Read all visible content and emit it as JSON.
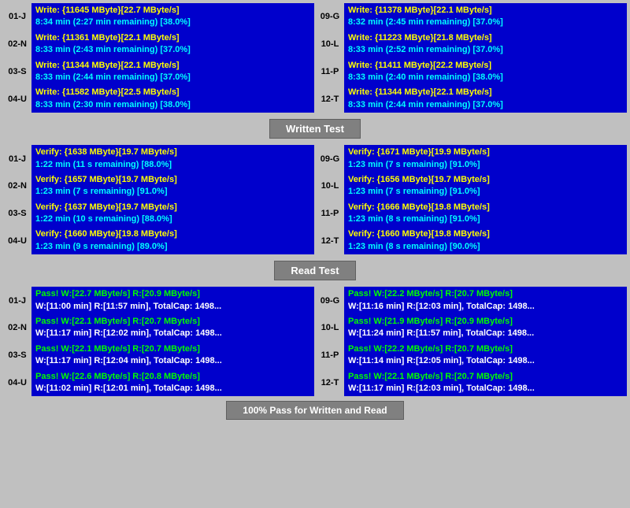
{
  "sections": {
    "write_test": {
      "label": "Written Test",
      "rows": [
        {
          "left": {
            "id": "01-J",
            "line1": "Write: {11645 MByte}[22.7 MByte/s]",
            "line2": "8:34 min (2:27 min remaining)  [38.0%]"
          },
          "right": {
            "id": "09-G",
            "line1": "Write: {11378 MByte}[22.1 MByte/s]",
            "line2": "8:32 min (2:45 min remaining)  [37.0%]"
          }
        },
        {
          "left": {
            "id": "02-N",
            "line1": "Write: {11361 MByte}[22.1 MByte/s]",
            "line2": "8:33 min (2:43 min remaining)  [37.0%]"
          },
          "right": {
            "id": "10-L",
            "line1": "Write: {11223 MByte}[21.8 MByte/s]",
            "line2": "8:33 min (2:52 min remaining)  [37.0%]"
          }
        },
        {
          "left": {
            "id": "03-S",
            "line1": "Write: {11344 MByte}[22.1 MByte/s]",
            "line2": "8:33 min (2:44 min remaining)  [37.0%]"
          },
          "right": {
            "id": "11-P",
            "line1": "Write: {11411 MByte}[22.2 MByte/s]",
            "line2": "8:33 min (2:40 min remaining)  [38.0%]"
          }
        },
        {
          "left": {
            "id": "04-U",
            "line1": "Write: {11582 MByte}[22.5 MByte/s]",
            "line2": "8:33 min (2:30 min remaining)  [38.0%]"
          },
          "right": {
            "id": "12-T",
            "line1": "Write: {11344 MByte}[22.1 MByte/s]",
            "line2": "8:33 min (2:44 min remaining)  [37.0%]"
          }
        }
      ]
    },
    "verify_test": {
      "label": "Written Test",
      "rows": [
        {
          "left": {
            "id": "01-J",
            "line1": "Verify: {1638 MByte}[19.7 MByte/s]",
            "line2": "1:22 min (11 s remaining)   [88.0%]"
          },
          "right": {
            "id": "09-G",
            "line1": "Verify: {1671 MByte}[19.9 MByte/s]",
            "line2": "1:23 min (7 s remaining)   [91.0%]"
          }
        },
        {
          "left": {
            "id": "02-N",
            "line1": "Verify: {1657 MByte}[19.7 MByte/s]",
            "line2": "1:23 min (7 s remaining)   [91.0%]"
          },
          "right": {
            "id": "10-L",
            "line1": "Verify: {1656 MByte}[19.7 MByte/s]",
            "line2": "1:23 min (7 s remaining)   [91.0%]"
          }
        },
        {
          "left": {
            "id": "03-S",
            "line1": "Verify: {1637 MByte}[19.7 MByte/s]",
            "line2": "1:22 min (10 s remaining)   [88.0%]"
          },
          "right": {
            "id": "11-P",
            "line1": "Verify: {1666 MByte}[19.8 MByte/s]",
            "line2": "1:23 min (8 s remaining)   [91.0%]"
          }
        },
        {
          "left": {
            "id": "04-U",
            "line1": "Verify: {1660 MByte}[19.8 MByte/s]",
            "line2": "1:23 min (9 s remaining)   [89.0%]"
          },
          "right": {
            "id": "12-T",
            "line1": "Verify: {1660 MByte}[19.8 MByte/s]",
            "line2": "1:23 min (8 s remaining)   [90.0%]"
          }
        }
      ]
    },
    "read_test": {
      "label": "Read Test",
      "rows": [
        {
          "left": {
            "id": "01-J",
            "line1": "Pass! W:[22.7 MByte/s] R:[20.9 MByte/s]",
            "line2": "W:[11:00 min] R:[11:57 min], TotalCap: 1498..."
          },
          "right": {
            "id": "09-G",
            "line1": "Pass! W:[22.2 MByte/s] R:[20.7 MByte/s]",
            "line2": "W:[11:16 min] R:[12:03 min], TotalCap: 1498..."
          }
        },
        {
          "left": {
            "id": "02-N",
            "line1": "Pass! W:[22.1 MByte/s] R:[20.7 MByte/s]",
            "line2": "W:[11:17 min] R:[12:02 min], TotalCap: 1498..."
          },
          "right": {
            "id": "10-L",
            "line1": "Pass! W:[21.9 MByte/s] R:[20.9 MByte/s]",
            "line2": "W:[11:24 min] R:[11:57 min], TotalCap: 1498..."
          }
        },
        {
          "left": {
            "id": "03-S",
            "line1": "Pass! W:[22.1 MByte/s] R:[20.7 MByte/s]",
            "line2": "W:[11:17 min] R:[12:04 min], TotalCap: 1498..."
          },
          "right": {
            "id": "11-P",
            "line1": "Pass! W:[22.2 MByte/s] R:[20.7 MByte/s]",
            "line2": "W:[11:14 min] R:[12:05 min], TotalCap: 1498..."
          }
        },
        {
          "left": {
            "id": "04-U",
            "line1": "Pass! W:[22.6 MByte/s] R:[20.8 MByte/s]",
            "line2": "W:[11:02 min] R:[12:01 min], TotalCap: 1498..."
          },
          "right": {
            "id": "12-T",
            "line1": "Pass! W:[22.1 MByte/s] R:[20.7 MByte/s]",
            "line2": "W:[11:17 min] R:[12:03 min], TotalCap: 1498..."
          }
        }
      ]
    }
  },
  "footer": "100% Pass for Written and Read",
  "headers": {
    "write": "Written Test",
    "read": "Read Test"
  }
}
